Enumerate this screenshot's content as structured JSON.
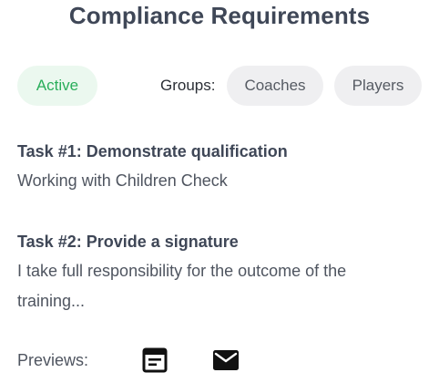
{
  "header": {
    "title": "Compliance Requirements"
  },
  "status": {
    "label": "Active"
  },
  "groups": {
    "label": "Groups:",
    "items": [
      "Coaches",
      "Players"
    ]
  },
  "tasks": [
    {
      "title": "Task #1: Demonstrate qualification",
      "body": "Working with Children Check"
    },
    {
      "title": "Task #2: Provide a signature",
      "body": "I take full responsibility for the outcome of the training..."
    }
  ],
  "previews": {
    "label": "Previews:",
    "icons": [
      "form-preview-icon",
      "mail-preview-icon"
    ]
  },
  "colors": {
    "title": "#3f4757",
    "active_bg": "#ebf8ef",
    "active_text": "#2aae5b",
    "group_bg": "#efeff1",
    "icon": "#111111"
  }
}
